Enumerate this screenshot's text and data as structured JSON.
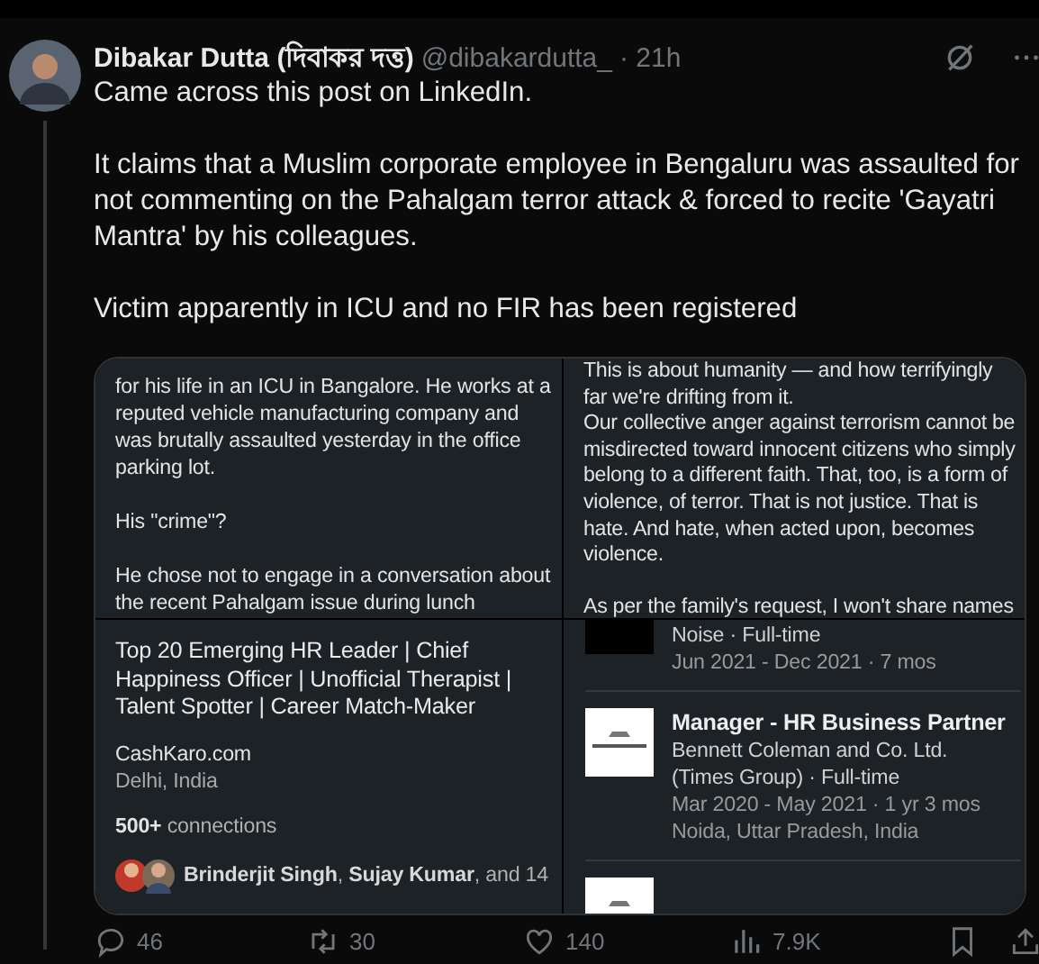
{
  "post": {
    "author": {
      "name": "Dibakar Dutta (দিবাকর দত্ত)",
      "handle": "@dibakardutta_",
      "time": "· 21h"
    },
    "paragraphs": [
      "Came across this post on LinkedIn.",
      "It claims that a Muslim corporate employee in Bengaluru was assaulted for not commenting on the Pahalgam terror attack & forced to recite 'Gayatri Mantra' by his colleagues.",
      "Victim apparently in ICU and no FIR has been registered"
    ],
    "media": {
      "panels": [
        {
          "kind": "post",
          "blocks": [
            [
              "for his life in an ICU in Bangalore. He works at a reputed vehicle manufacturing company and was brutally assaulted yesterday in the office parking lot."
            ],
            [
              "His \"crime\"?"
            ],
            [
              "He chose not to engage in a conversation about the recent Pahalgam issue during lunch"
            ]
          ]
        },
        {
          "kind": "post",
          "blocks": [
            [
              "This is about humanity — and how terrifyingly far we're drifting from it.",
              "Our collective anger against terrorism cannot be misdirected toward innocent citizens who simply belong to a different faith. That, too, is a form of violence, of terror. That is not justice. That is hate. And hate, when acted upon, becomes violence."
            ],
            [
              "As per the family's request, I won't share names"
            ]
          ]
        },
        {
          "kind": "profile",
          "headline": "Top 20 Emerging HR Leader | Chief Happiness Officer | Unofficial Therapist | Talent Spotter | Career Match-Maker",
          "company": "CashKaro.com",
          "location": "Delhi, India",
          "connections": "**500+** connections",
          "mutuals": "**Brinderjit Singh**, **Sujay Kumar**, and 14"
        },
        {
          "kind": "experience",
          "items": [
            {
              "kind": "dark",
              "lines": [
                "Noise · Full-time",
                "Jun 2021 - Dec 2021 · 7 mos"
              ]
            },
            {
              "kind": "light",
              "title": "Manager - HR Business Partner",
              "lines": [
                "Bennett Coleman and Co. Ltd. (Times Group) · Full-time",
                "Mar 2020 - May 2021 · 1 yr 3 mos",
                "Noida, Uttar Pradesh, India"
              ]
            },
            {
              "kind": "light"
            }
          ]
        }
      ]
    }
  },
  "actions": [
    {
      "kind": "reply",
      "count": "46"
    },
    {
      "kind": "repost",
      "count": "30"
    },
    {
      "kind": "like",
      "count": "140"
    },
    {
      "kind": "views",
      "count": "7.9K"
    },
    {
      "kind": "bookmark"
    },
    {
      "kind": "share"
    }
  ]
}
